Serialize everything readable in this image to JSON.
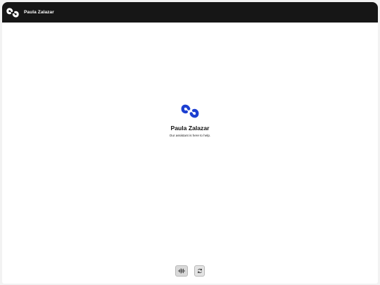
{
  "header": {
    "title": "Paula Zalazar",
    "logo_icon": "swirl-logo-icon"
  },
  "welcome": {
    "logo_icon": "swirl-logo-icon",
    "name": "Paula Zalazar",
    "tagline": "Our assistant is here to help."
  },
  "controls": {
    "voice_icon": "audio-waveform-icon",
    "refresh_icon": "refresh-icon"
  },
  "colors": {
    "header_bg": "#161616",
    "accent": "#1c3fd1",
    "page_bg": "#ffffff"
  }
}
